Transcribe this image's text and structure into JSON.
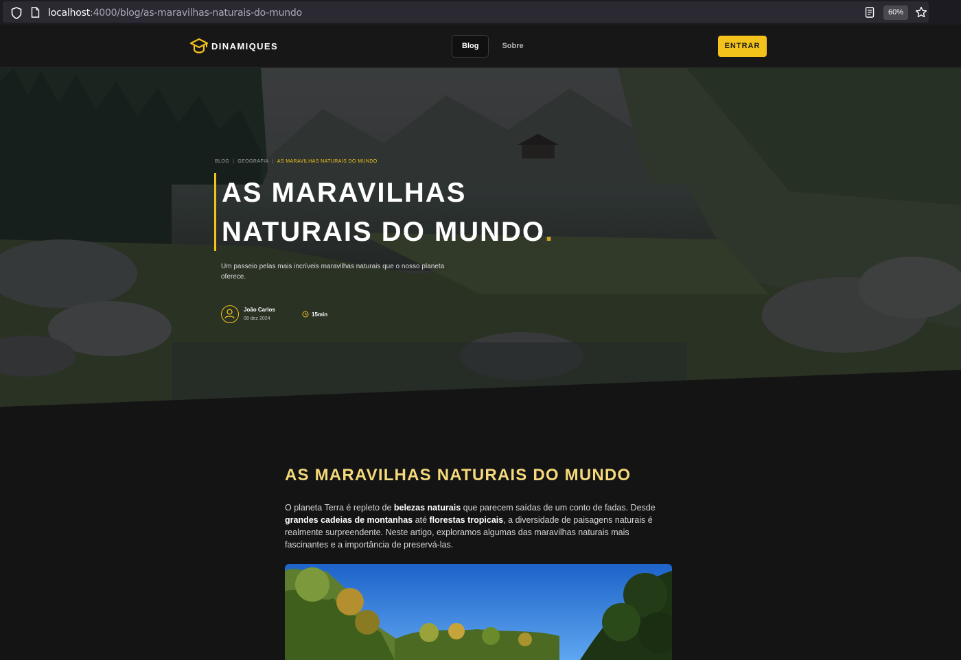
{
  "browser": {
    "url_host": "localhost",
    "url_path": ":4000/blog/as-maravilhas-naturais-do-mundo",
    "zoom": "60%"
  },
  "header": {
    "logo_text": "DINAMIQUES",
    "nav": [
      {
        "label": "Blog",
        "active": true
      },
      {
        "label": "Sobre",
        "active": false
      }
    ],
    "login_label": "ENTRAR"
  },
  "hero": {
    "breadcrumb": [
      "BLOG",
      "GEOGRAFIA",
      "AS MARAVILHAS NATURAIS DO MUNDO"
    ],
    "title_line1": "AS MARAVILHAS",
    "title_line2": "NATURAIS DO MUNDO",
    "title_dot": ".",
    "subtitle": "Um passeio pelas mais incríveis maravilhas naturais que o nosso planeta oferece.",
    "author_name": "João Carlos",
    "author_date": "08 dez 2024",
    "read_time": "15min"
  },
  "article": {
    "title": "AS MARAVILHAS NATURAIS DO MUNDO",
    "p1_a": "O planeta Terra é repleto de ",
    "p1_b": "belezas naturais",
    "p1_c": " que parecem saídas de um conto de fadas. Desde ",
    "p1_d": "grandes cadeias de montanhas",
    "p1_e": " até ",
    "p1_f": "florestas tropicais",
    "p1_g": ", a diversidade de paisagens naturais é realmente surpreendente. Neste artigo, exploramos algumas das maravilhas naturais mais fascinantes e a importância de preservá-las."
  },
  "colors": {
    "accent": "#f3c21b",
    "article_title": "#f5d97a",
    "background": "#141414"
  }
}
